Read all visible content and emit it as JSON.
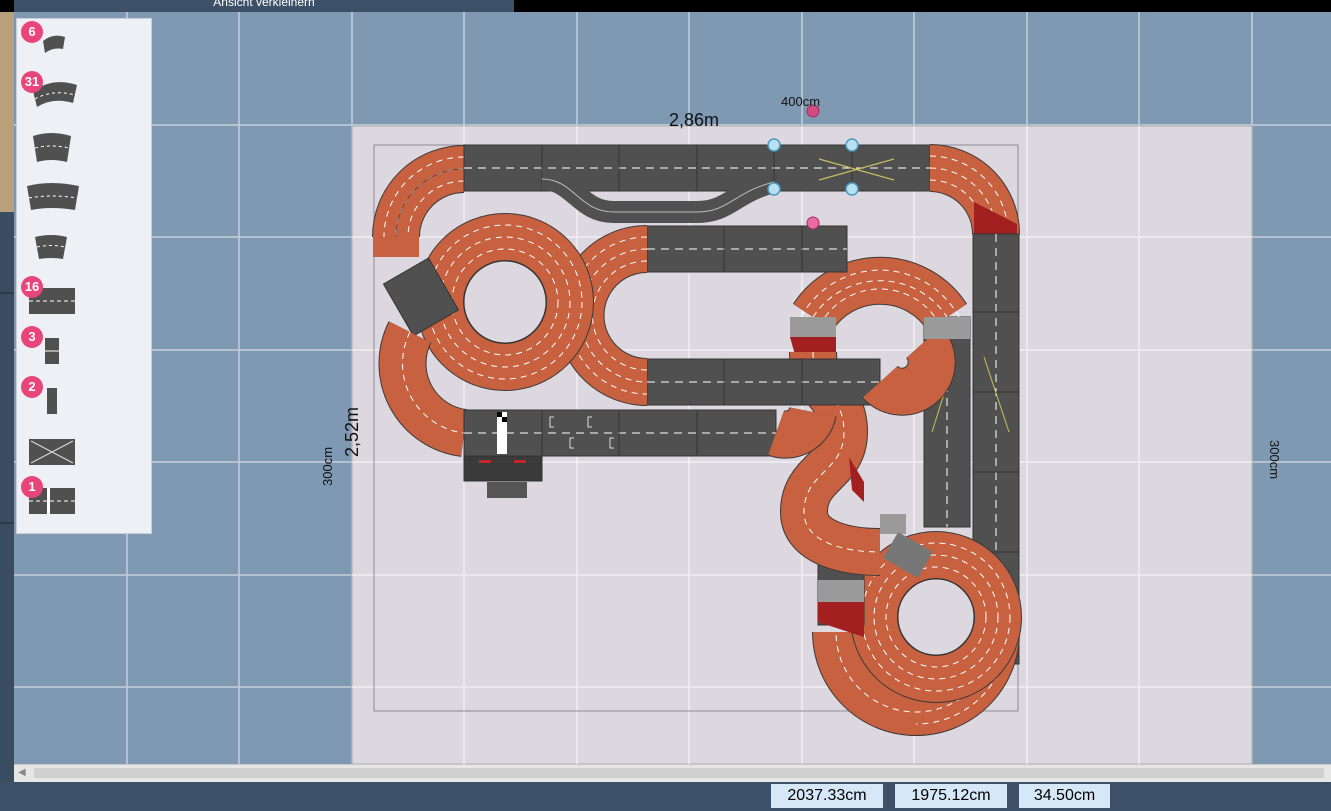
{
  "toolbar": {
    "zoom_out_label": "Ansicht verkleinern"
  },
  "palette": {
    "items": [
      {
        "name": "curve-small",
        "count": "6"
      },
      {
        "name": "curve-1-60",
        "count": "31"
      },
      {
        "name": "curve-2",
        "count": ""
      },
      {
        "name": "curve-3",
        "count": ""
      },
      {
        "name": "curve-4",
        "count": ""
      },
      {
        "name": "straight-full",
        "count": "16"
      },
      {
        "name": "straight-third",
        "count": "3"
      },
      {
        "name": "straight-quarter",
        "count": "2"
      },
      {
        "name": "crossing",
        "count": ""
      },
      {
        "name": "start-finish",
        "count": "1"
      }
    ]
  },
  "plan": {
    "width_label": "400cm",
    "height_label": "300cm",
    "height_label_right": "300cm",
    "track_width": "2,86m",
    "track_height": "2,52m"
  },
  "status": {
    "x": "2037.33cm",
    "y": "1975.12cm",
    "zoom": "34.50cm"
  },
  "colors": {
    "grid_bg": "#7f99b3",
    "plate": "#ddd8e0",
    "asphalt": "#505050",
    "curb": "#c8613f",
    "curb_dark": "#a32020",
    "accent": "#e8457a",
    "status_bg": "#d6e8f8"
  }
}
